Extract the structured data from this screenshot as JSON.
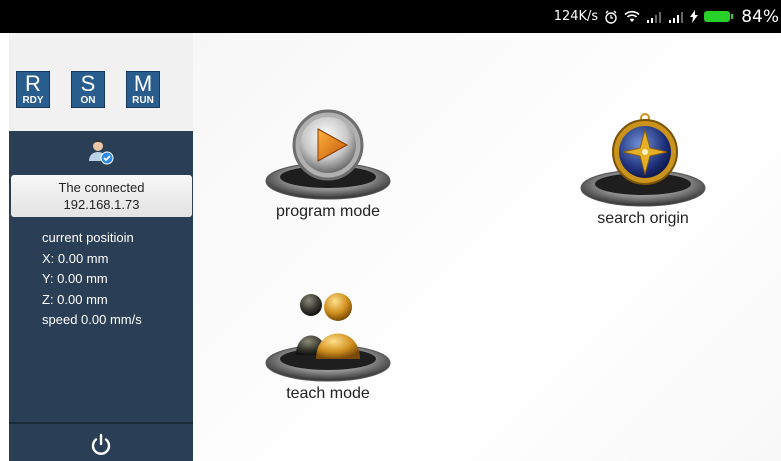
{
  "status_bar": {
    "speed": "124K/s",
    "battery_percent": "84%",
    "icons": [
      "alarm-icon",
      "wifi-icon",
      "signal-icon",
      "signal-icon",
      "charging-icon",
      "battery-icon"
    ]
  },
  "sidebar": {
    "badges": [
      {
        "letter": "R",
        "sub": "RDY"
      },
      {
        "letter": "S",
        "sub": "ON"
      },
      {
        "letter": "M",
        "sub": "RUN"
      }
    ],
    "connection": {
      "status": "The connected",
      "ip": "192.168.1.73"
    },
    "position": {
      "title": "current positioin",
      "x": "X: 0.00 mm",
      "y": "Y: 0.00 mm",
      "z": "Z: 0.00 mm",
      "speed": "speed 0.00 mm/s"
    }
  },
  "main": {
    "program_mode": "program mode",
    "search_origin": "search origin",
    "teach_mode": "teach mode"
  },
  "colors": {
    "sidebar": "#2a3f55",
    "badge": "#295d8d",
    "battery": "#27d12a"
  }
}
